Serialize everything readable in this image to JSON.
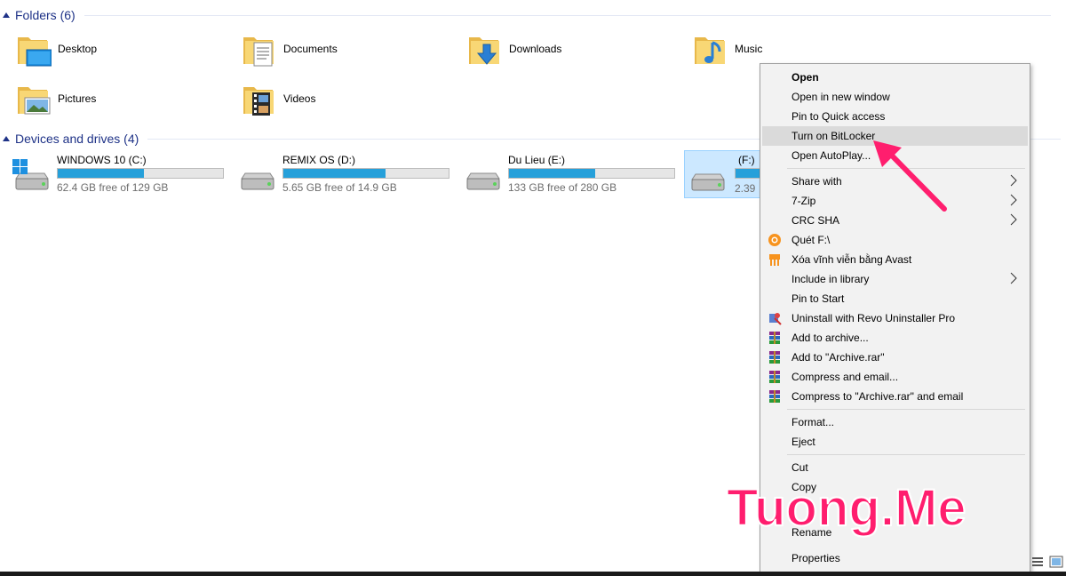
{
  "folders_section": {
    "title": "Folders (6)",
    "items": [
      {
        "name": "Desktop",
        "icon": "desktop-folder-icon"
      },
      {
        "name": "Documents",
        "icon": "documents-folder-icon"
      },
      {
        "name": "Downloads",
        "icon": "downloads-folder-icon"
      },
      {
        "name": "Music",
        "icon": "music-folder-icon"
      },
      {
        "name": "Pictures",
        "icon": "pictures-folder-icon"
      },
      {
        "name": "Videos",
        "icon": "videos-folder-icon"
      }
    ]
  },
  "drives_section": {
    "title": "Devices and drives (4)",
    "items": [
      {
        "name": "WINDOWS 10 (C:)",
        "free": "62.4 GB free of 129 GB",
        "used_fraction": 0.52,
        "icon": "windows-drive-icon"
      },
      {
        "name": "REMIX  OS (D:)",
        "free": "5.65 GB free of 14.9 GB",
        "used_fraction": 0.62,
        "icon": "hard-drive-icon"
      },
      {
        "name": "Du Lieu (E:)",
        "free": "133 GB free of 280 GB",
        "used_fraction": 0.52,
        "icon": "hard-drive-icon"
      },
      {
        "name": "(F:)",
        "free": "2.39",
        "used_fraction": 0.55,
        "icon": "hard-drive-icon",
        "selected": true
      }
    ]
  },
  "context_menu": {
    "items": [
      {
        "label": "Open",
        "bold": true
      },
      {
        "label": "Open in new window"
      },
      {
        "label": "Pin to Quick access"
      },
      {
        "label": "Turn on BitLocker",
        "highlighted": true
      },
      {
        "label": "Open AutoPlay..."
      },
      {
        "label": "Share with",
        "submenu": true
      },
      {
        "label": "7-Zip",
        "submenu": true
      },
      {
        "label": "CRC SHA",
        "submenu": true
      },
      {
        "label": "Quét F:\\",
        "icon": "avast-icon"
      },
      {
        "label": "Xóa vĩnh viễn bằng Avast",
        "icon": "shredder-icon"
      },
      {
        "label": "Include in library",
        "submenu": true
      },
      {
        "label": "Pin to Start"
      },
      {
        "label": "Uninstall with Revo Uninstaller Pro",
        "icon": "revo-icon"
      },
      {
        "label": "Add to archive...",
        "icon": "winrar-icon"
      },
      {
        "label": "Add to \"Archive.rar\"",
        "icon": "winrar-icon"
      },
      {
        "label": "Compress and email...",
        "icon": "winrar-icon"
      },
      {
        "label": "Compress to \"Archive.rar\" and email",
        "icon": "winrar-icon"
      },
      {
        "label": "Format..."
      },
      {
        "label": "Eject"
      },
      {
        "label": "Cut"
      },
      {
        "label": "Copy"
      },
      {
        "label": "Rename"
      },
      {
        "label": "Properties"
      }
    ]
  },
  "watermark": "Tuong.Me",
  "colors": {
    "accent": "#1e3287",
    "selection": "#cce8ff",
    "bar_fill": "#26a0da",
    "menu_highlight": "#dadada",
    "annotation": "#ff1e6e"
  }
}
